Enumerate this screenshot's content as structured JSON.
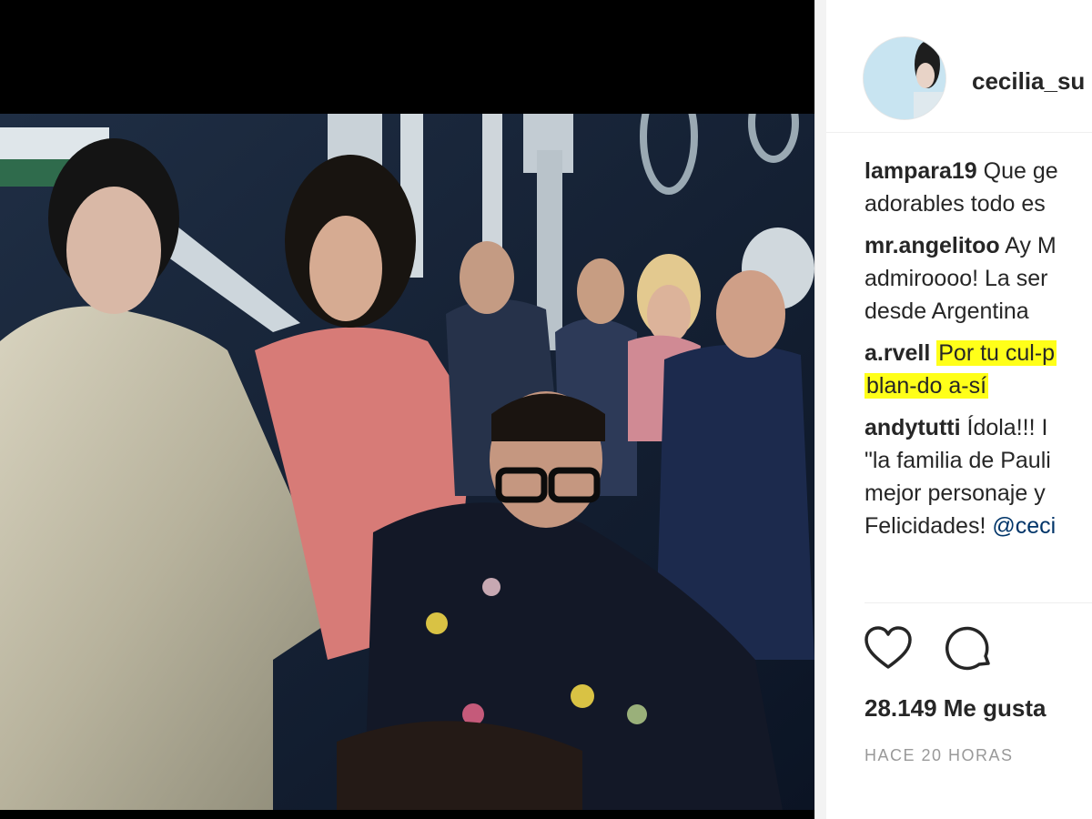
{
  "post": {
    "username": "cecilia_su",
    "likes_text": "28.149 Me gusta",
    "time_text": "HACE 20 HORAS"
  },
  "comments": [
    {
      "user": "lampara19",
      "lines": [
        "Que ge",
        "adorables todo es"
      ]
    },
    {
      "user": "mr.angelitoo",
      "lines": [
        "Ay M",
        "admiroooo! La ser",
        "desde Argentina"
      ]
    },
    {
      "user": "a.rvell",
      "lines": [
        "Por tu cul-p",
        "blan-do a-sí"
      ],
      "highlight": true
    },
    {
      "user": "andytutti",
      "lines": [
        "Ídola!!! I",
        "\"la familia de Pauli",
        "mejor personaje y",
        "Felicidades!"
      ],
      "mention": "@ceci"
    }
  ],
  "icons": {
    "like": "heart-icon",
    "comment": "speech-bubble-icon"
  },
  "colors": {
    "highlight": "#ffff19",
    "text": "#262626",
    "muted": "#999999",
    "mention": "#003569"
  }
}
